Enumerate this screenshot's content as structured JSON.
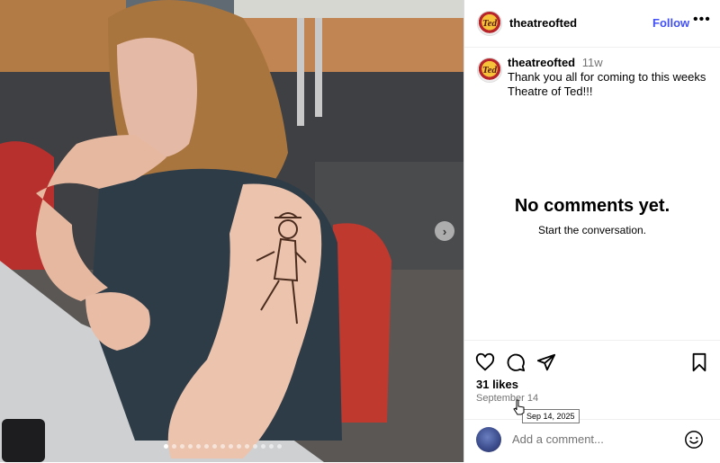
{
  "post": {
    "username": "theatreofted",
    "follow_label": "Follow",
    "more_label": "•••",
    "avatar_text": "Ted",
    "caption": {
      "username": "theatreofted",
      "time": "11w",
      "text": "Thank you all for coming to this weeks Theatre of Ted!!!"
    },
    "comments_empty": {
      "title": "No comments yet.",
      "subtitle": "Start the conversation."
    },
    "likes": "31 likes",
    "date": "September 14",
    "date_tooltip": "Sep 14, 2025",
    "comment_placeholder": "Add a comment...",
    "carousel": {
      "slide_count": 15,
      "active_index": 0,
      "next_label": "›"
    }
  },
  "icons": [
    "heart-icon",
    "comment-icon",
    "share-icon",
    "bookmark-icon",
    "emoji-icon",
    "next-arrow-icon",
    "more-icon"
  ]
}
